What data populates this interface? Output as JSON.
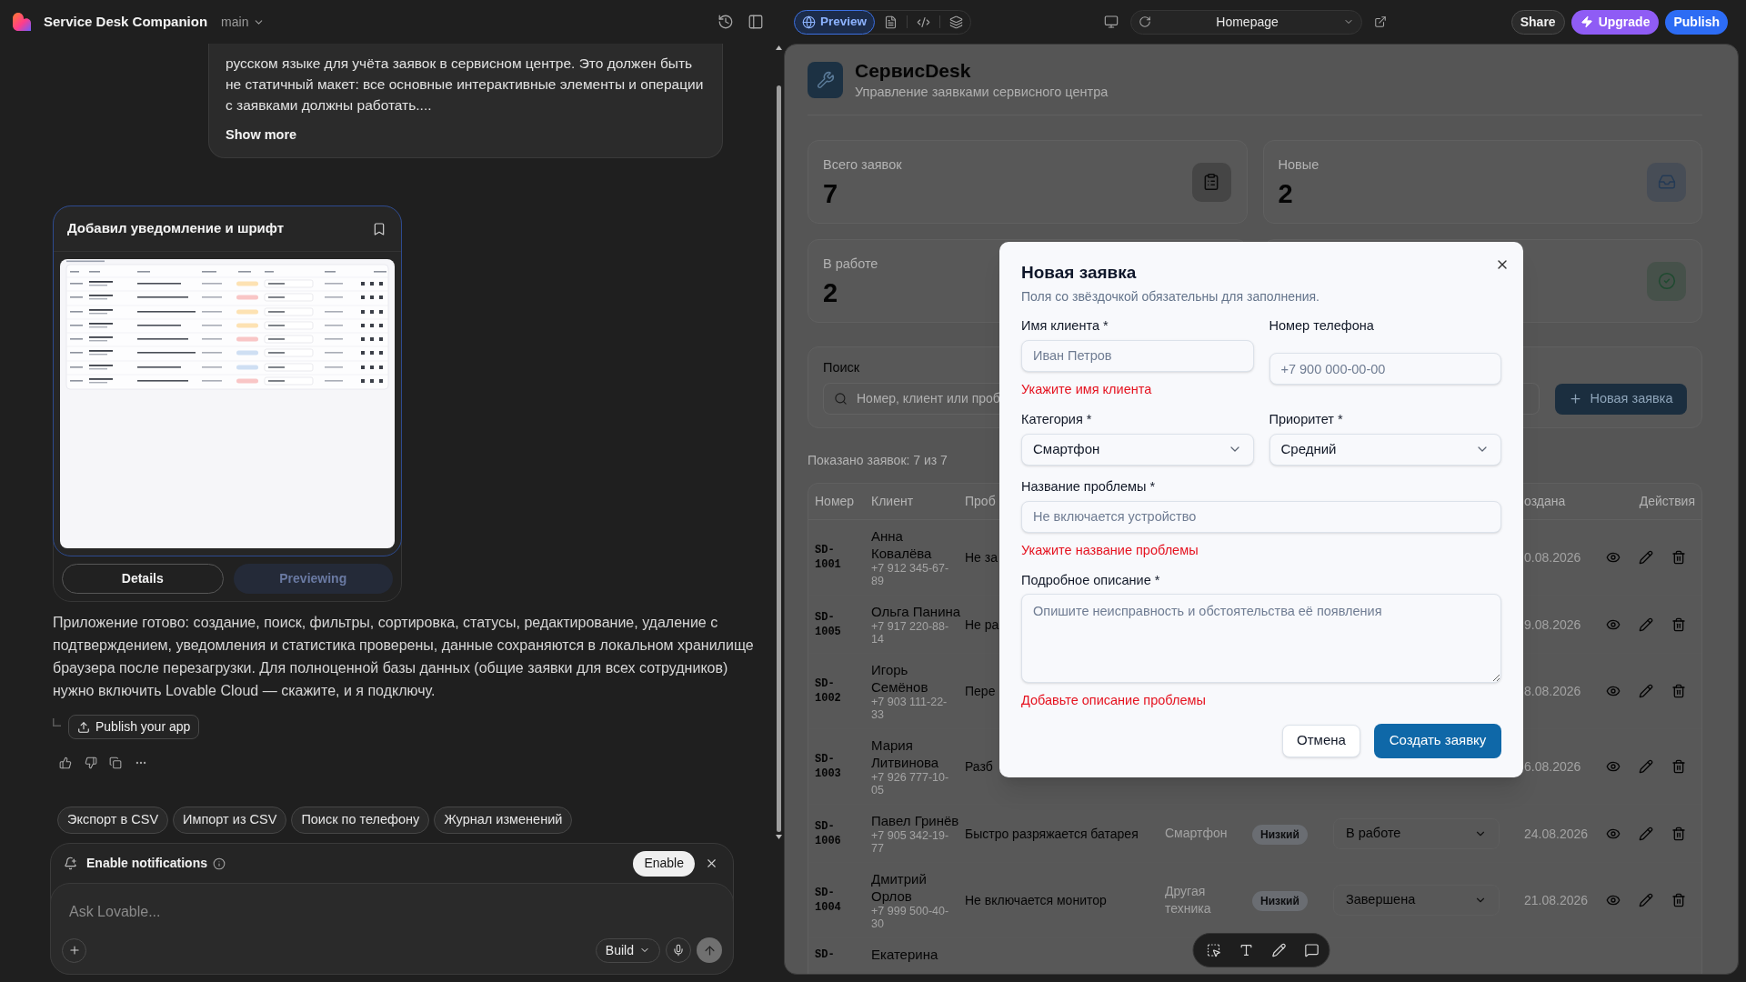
{
  "header": {
    "project": "Service Desk Companion",
    "branch": "main"
  },
  "chat": {
    "user_message": {
      "text": "русском языке для учёта заявок в сервисном центре. Это должен быть не статичный макет: все основные интерактивные элементы и операции с заявками должны работать....",
      "show_more": "Show more"
    },
    "version_card": {
      "title": "Добавил уведомление и шрифт",
      "buttons": [
        {
          "label": "Details",
          "selected": false
        },
        {
          "label": "Previewing",
          "selected": true
        }
      ]
    },
    "assistant_message": "Приложение готово: создание, поиск, фильтры, сортировка, статусы, редактирование, удаление с подтверждением, уведомления и статистика проверены, данные сохраняются в локальном хранилище браузера после перезагрузки. Для полноценной базы данных (общие заявки для всех сотрудников) нужно включить Lovable Cloud — скажите, и я подключу.",
    "publish_button": "Publish your app",
    "suggestions": [
      "Экспорт в CSV",
      "Импорт из CSV",
      "Поиск по телефону",
      "Журнал изменений"
    ],
    "notification": {
      "title": "Enable notifications",
      "button": "Enable"
    },
    "composer": {
      "placeholder": "Ask Lovable...",
      "mode": "Build"
    }
  },
  "preview_bar": {
    "tabs": [
      {
        "kind": "preview",
        "label": "Preview",
        "selected": true
      },
      {
        "kind": "files",
        "selected": false
      },
      {
        "kind": "code",
        "selected": false
      },
      {
        "kind": "layers",
        "selected": false
      }
    ],
    "page": "Homepage",
    "share": "Share",
    "upgrade": "Upgrade",
    "publish": "Publish"
  },
  "app": {
    "title": "СервисDesk",
    "subtitle": "Управление заявками сервисного центра",
    "stats": [
      {
        "kind": "total",
        "label": "Всего заявок",
        "value": "7"
      },
      {
        "kind": "new",
        "label": "Новые",
        "value": "2"
      },
      {
        "label": "В работе",
        "value": "2"
      },
      {
        "kind": "done"
      }
    ],
    "search": {
      "label": "Поиск",
      "placeholder": "Номер, клиент или проб"
    },
    "new_button": "Новая заявка",
    "count": "Показано заявок: 7 из 7",
    "columns": {
      "number": "Номер",
      "client": "Клиент",
      "problem": "Проб",
      "created": "оздана",
      "actions": "Действия"
    },
    "rows": [
      {
        "number": "SD-1001",
        "client": "Анна Ковалёва",
        "phone": "+7 912 345-67-89",
        "problem": "Не за",
        "created": "0.08.2026"
      },
      {
        "number": "SD-1005",
        "client": "Ольга Панина",
        "phone": "+7 917 220-88-14",
        "problem": "Не ра",
        "created": "9.08.2026"
      },
      {
        "number": "SD-1002",
        "client": "Игорь Семёнов",
        "phone": "+7 903 111-22-33",
        "problem": "Пере",
        "created": "8.08.2026"
      },
      {
        "number": "SD-1003",
        "client": "Мария Литвинова",
        "phone": "+7 926 777-10-05",
        "problem": "Разб",
        "created": "6.08.2026"
      },
      {
        "number": "SD-1006",
        "client": "Павел Гринёв",
        "phone": "+7 905 342-19-77",
        "problem": "Быстро разряжается батарея",
        "category": "Смартфон",
        "priority": "Низкий",
        "status": "В работе",
        "created": "24.08.2026"
      },
      {
        "number": "SD-1004",
        "client": "Дмитрий Орлов",
        "phone": "+7 999 500-40-30",
        "problem": "Не включается монитор",
        "category": "Другая техника",
        "priority": "Низкий",
        "status": "Завершена",
        "created": "21.08.2026"
      },
      {
        "number": "SD-",
        "client": "Екатерина"
      }
    ],
    "modal": {
      "title": "Новая заявка",
      "description": "Поля со звёздочкой обязательны для заполнения.",
      "fields": [
        {
          "kind": "input",
          "label": "Имя клиента *",
          "placeholder": "Иван Петров",
          "error": "Укажите имя клиента"
        },
        {
          "kind": "input",
          "label": "Номер телефона",
          "placeholder": "+7 900 000-00-00"
        },
        {
          "kind": "select",
          "label": "Категория *",
          "value": "Смартфон"
        },
        {
          "kind": "select",
          "label": "Приоритет *",
          "value": "Средний"
        },
        {
          "kind": "input",
          "label": "Название проблемы *",
          "placeholder": "Не включается устройство",
          "error": "Укажите название проблемы"
        },
        {
          "kind": "textarea",
          "label": "Подробное описание *",
          "placeholder": "Опишите неисправность и обстоятельства её появления",
          "error": "Добавьте описание проблемы"
        }
      ],
      "cancel": "Отмена",
      "submit": "Создать заявку"
    }
  }
}
